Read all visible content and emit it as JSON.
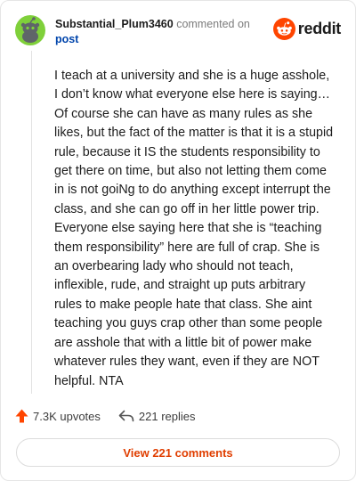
{
  "comment": {
    "username": "Substantial_Plum3460",
    "commented_on": "commented on",
    "post_link": "post",
    "body": "I teach at a university and she is a huge asshole, I don’t know what everyone else here is saying… Of course she can have as many rules as she likes, but the fact of the matter is that it is a stupid rule, because it IS the students responsibility to get there on time, but also not letting them come in is not goiNg to do anything except interrupt the class, and she can go off in her little power trip. Everyone else saying here that she is “teaching them responsibility” here are full of crap. She is an overbearing lady who should not teach, inflexible, rude, and straight up puts arbitrary rules to make people hate that class. She aint teaching you guys crap other than some people are asshole that with a little bit of power make whatever rules they want, even if they are NOT helpful. NTA",
    "upvotes": "7.3K upvotes",
    "replies": "221 replies"
  },
  "brand": {
    "wordmark": "reddit",
    "icon": "reddit-snoo-icon",
    "color": "#ff4500"
  },
  "avatar": {
    "icon": "snoo-avatar-icon",
    "color": "#7fd03a"
  },
  "footer": {
    "view_comments_label": "View 221 comments"
  },
  "colors": {
    "accent": "#ff4500",
    "link": "#0045ac",
    "button_text": "#e03e00"
  }
}
